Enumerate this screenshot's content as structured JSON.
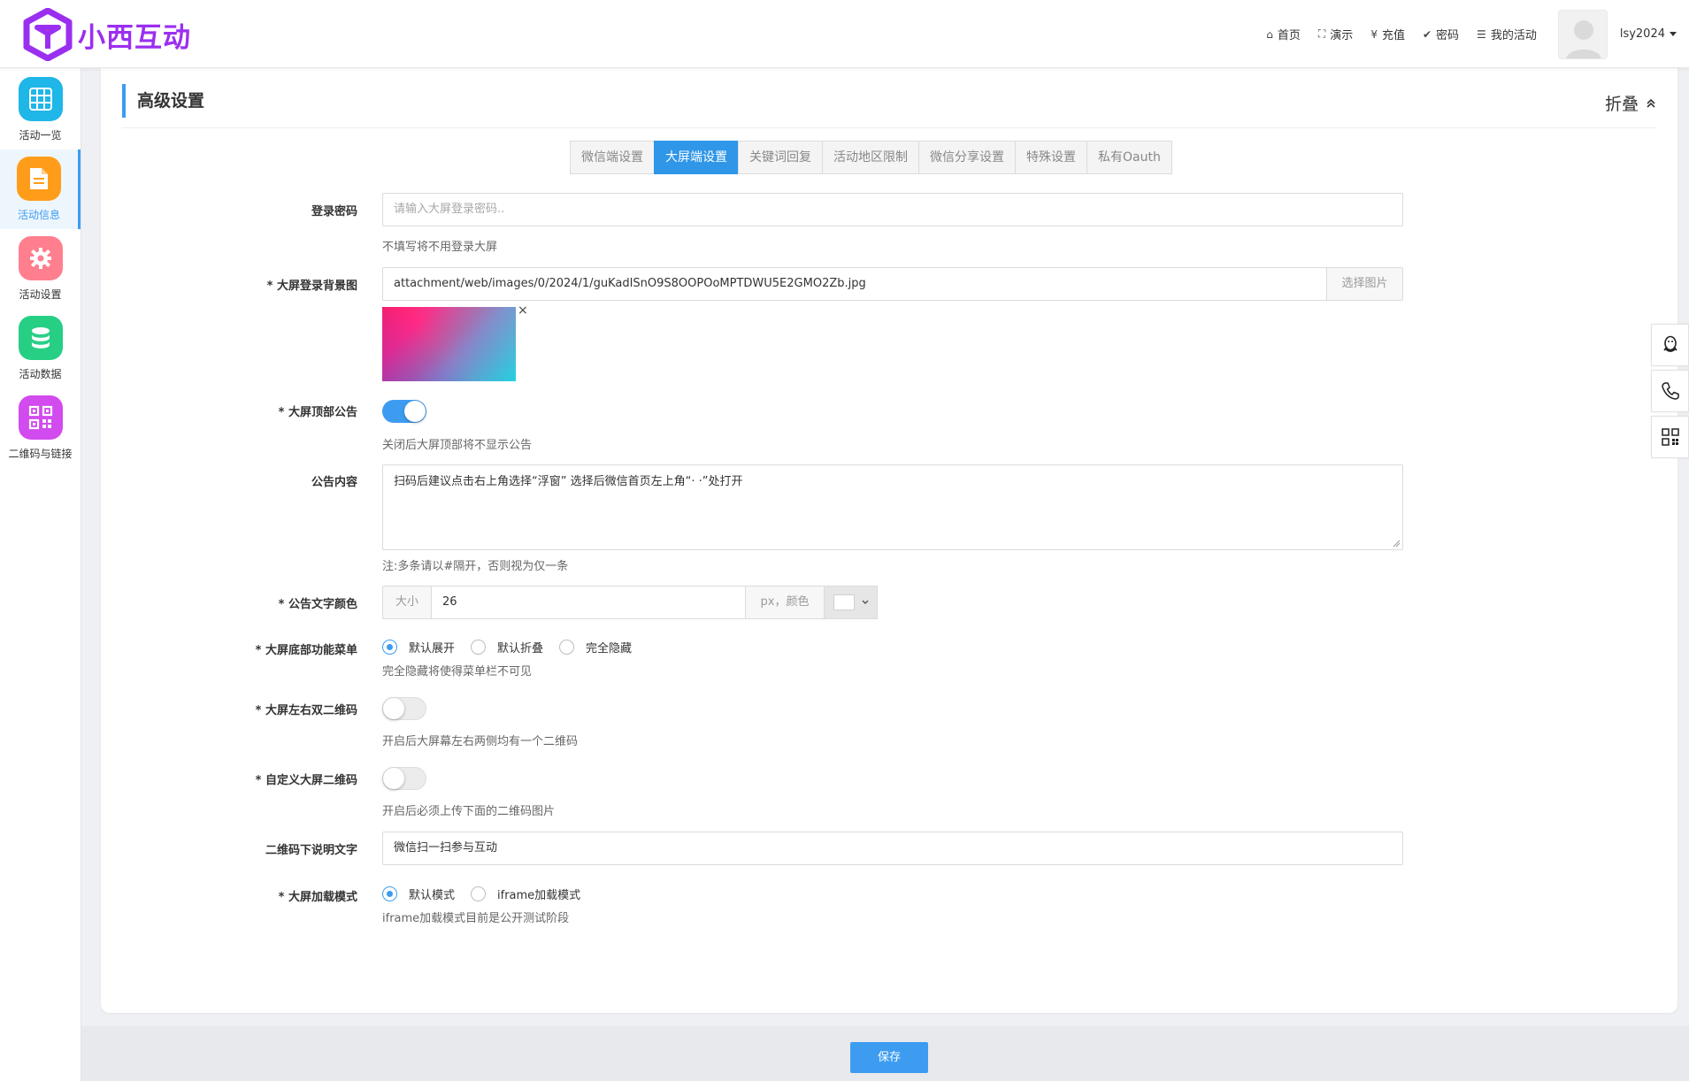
{
  "app": {
    "logo_text": "小西互动"
  },
  "topnav": {
    "items": [
      {
        "icon": "home-icon",
        "glyph": "⌂",
        "label": "首页"
      },
      {
        "icon": "fullscreen-icon",
        "glyph": "⛶",
        "label": "演示"
      },
      {
        "icon": "yen-icon",
        "glyph": "¥",
        "label": "充值"
      },
      {
        "icon": "shield-check-icon",
        "glyph": "✔",
        "label": "密码"
      },
      {
        "icon": "list-icon",
        "glyph": "☰",
        "label": "我的活动"
      }
    ],
    "username": "lsy2024"
  },
  "sidebar": {
    "items": [
      {
        "label": "活动一览",
        "icon": "grid-icon",
        "color": "#1fb6e8"
      },
      {
        "label": "活动信息",
        "icon": "document-icon",
        "color": "#ff9d1a",
        "active": true
      },
      {
        "label": "活动设置",
        "icon": "gear-icon",
        "color": "#ff7f8f"
      },
      {
        "label": "活动数据",
        "icon": "database-icon",
        "color": "#27cf85"
      },
      {
        "label": "二维码与链接",
        "icon": "qrcode-icon",
        "color": "#d24bef"
      }
    ]
  },
  "section": {
    "title": "高级设置",
    "fold_label": "折叠"
  },
  "tabs": [
    {
      "label": "微信端设置"
    },
    {
      "label": "大屏端设置",
      "active": true
    },
    {
      "label": "关键词回复"
    },
    {
      "label": "活动地区限制"
    },
    {
      "label": "微信分享设置"
    },
    {
      "label": "特殊设置"
    },
    {
      "label": "私有Oauth"
    }
  ],
  "form": {
    "login_password": {
      "label": "登录密码",
      "placeholder": "请输入大屏登录密码..",
      "help": "不填写将不用登录大屏"
    },
    "bg_image": {
      "label": "* 大屏登录背景图",
      "value": "attachment/web/images/0/2024/1/guKadISnO9S8OOPOoMPTDWU5E2GMO2Zb.jpg",
      "button": "选择图片",
      "close": "×"
    },
    "top_notice": {
      "label": "* 大屏顶部公告",
      "enabled": true,
      "help": "关闭后大屏顶部将不显示公告"
    },
    "notice_content": {
      "label": "公告内容",
      "value": "扫码后建议点击右上角选择“浮窗” 选择后微信首页左上角“· ·”处打开",
      "help": "注:多条请以#隔开，否则视为仅一条"
    },
    "notice_font": {
      "label": "* 公告文字颜色",
      "size_prefix": "大小",
      "size_value": "26",
      "size_suffix": "px，颜色",
      "color": "#ffffff"
    },
    "bottom_menu": {
      "label": "* 大屏底部功能菜单",
      "options": [
        "默认展开",
        "默认折叠",
        "完全隐藏"
      ],
      "selected": 0,
      "help": "完全隐藏将使得菜单栏不可见"
    },
    "dual_qr": {
      "label": "* 大屏左右双二维码",
      "enabled": false,
      "help": "开启后大屏幕左右两侧均有一个二维码"
    },
    "custom_qr": {
      "label": "* 自定义大屏二维码",
      "enabled": false,
      "help": "开启后必须上传下面的二维码图片"
    },
    "qr_caption": {
      "label": "二维码下说明文字",
      "value": "微信扫一扫参与互动"
    },
    "load_mode": {
      "label": "* 大屏加载模式",
      "options": [
        "默认模式",
        "iframe加载模式"
      ],
      "selected": 0,
      "help": "iframe加载模式目前是公开测试阶段"
    }
  },
  "float_buttons": [
    {
      "icon": "qq-icon"
    },
    {
      "icon": "phone-icon"
    },
    {
      "icon": "qrcode-icon"
    }
  ],
  "save_label": "保存"
}
